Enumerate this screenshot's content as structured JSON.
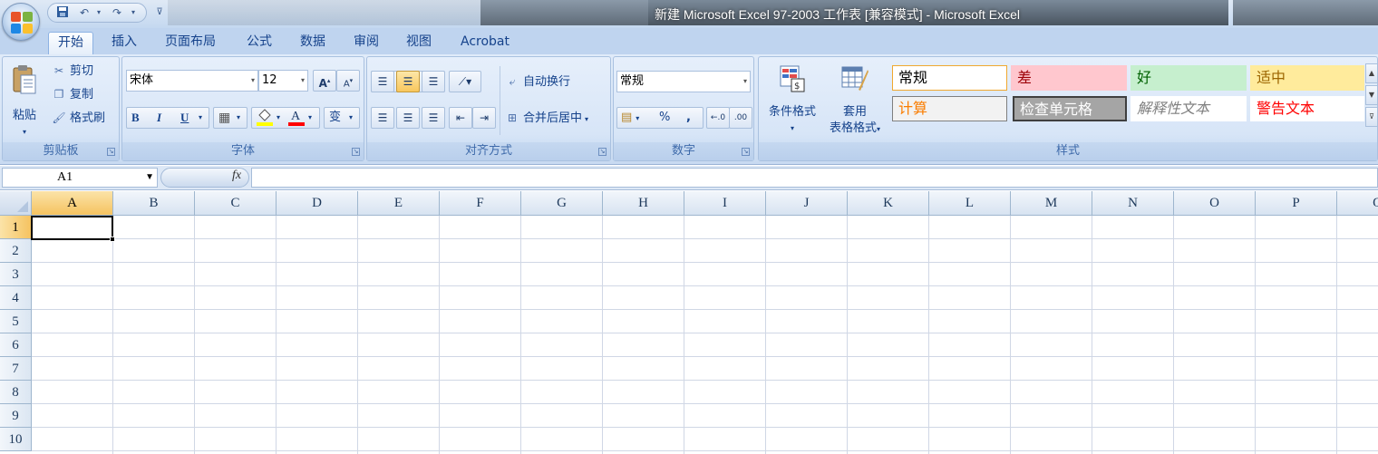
{
  "window": {
    "title": "新建 Microsoft Excel 97-2003 工作表  [兼容模式] - Microsoft Excel"
  },
  "quick_access": {
    "save_icon": "save-icon",
    "undo_icon": "undo-icon",
    "redo_icon": "redo-icon",
    "customize_icon": "customize-qat-icon"
  },
  "tabs": [
    "开始",
    "插入",
    "页面布局",
    "公式",
    "数据",
    "审阅",
    "视图",
    "Acrobat"
  ],
  "active_tab": "开始",
  "ribbon": {
    "clipboard": {
      "label": "剪贴板",
      "paste": "粘贴",
      "cut": "剪切",
      "copy": "复制",
      "format_painter": "格式刷"
    },
    "font": {
      "label": "字体",
      "font_name": "宋体",
      "font_size": "12",
      "bold": "B",
      "italic": "I",
      "underline": "U",
      "grow": "A",
      "shrink": "A",
      "phonetic": "变",
      "fill_color": "#ffff00",
      "font_color": "#ff0000"
    },
    "alignment": {
      "label": "对齐方式",
      "wrap_text": "自动换行",
      "merge_center": "合并后居中"
    },
    "number": {
      "label": "数字",
      "format": "常规",
      "percent": "%",
      "comma": ","
    },
    "styles": {
      "label": "样式",
      "conditional_format": "条件格式",
      "format_table_line1": "套用",
      "format_table_line2": "表格格式",
      "cells": [
        {
          "text": "常规",
          "bg": "#ffffff",
          "fg": "#000000",
          "border": "#f0a830"
        },
        {
          "text": "差",
          "bg": "#ffc7ce",
          "fg": "#9c0006",
          "border": "#ffc7ce"
        },
        {
          "text": "好",
          "bg": "#c6efce",
          "fg": "#006100",
          "border": "#c6efce"
        },
        {
          "text": "适中",
          "bg": "#ffeb9c",
          "fg": "#9c6500",
          "border": "#ffeb9c"
        },
        {
          "text": "计算",
          "bg": "#f2f2f2",
          "fg": "#fa7d00",
          "border": "#7f7f7f"
        },
        {
          "text": "检查单元格",
          "bg": "#a5a5a5",
          "fg": "#ffffff",
          "border": "#3f3f3f"
        },
        {
          "text": "解释性文本",
          "bg": "#ffffff",
          "fg": "#7f7f7f",
          "border": "#ffffff"
        },
        {
          "text": "警告文本",
          "bg": "#ffffff",
          "fg": "#ff0000",
          "border": "#ffffff"
        }
      ]
    }
  },
  "formula_bar": {
    "name_box": "A1",
    "fx_label": "fx",
    "formula": ""
  },
  "sheet": {
    "columns": [
      "A",
      "B",
      "C",
      "D",
      "E",
      "F",
      "G",
      "H",
      "I",
      "J",
      "K",
      "L",
      "M",
      "N",
      "O",
      "P",
      "Q"
    ],
    "rows": [
      "1",
      "2",
      "3",
      "4",
      "5",
      "6",
      "7",
      "8",
      "9",
      "10"
    ],
    "active_cell": "A1"
  }
}
